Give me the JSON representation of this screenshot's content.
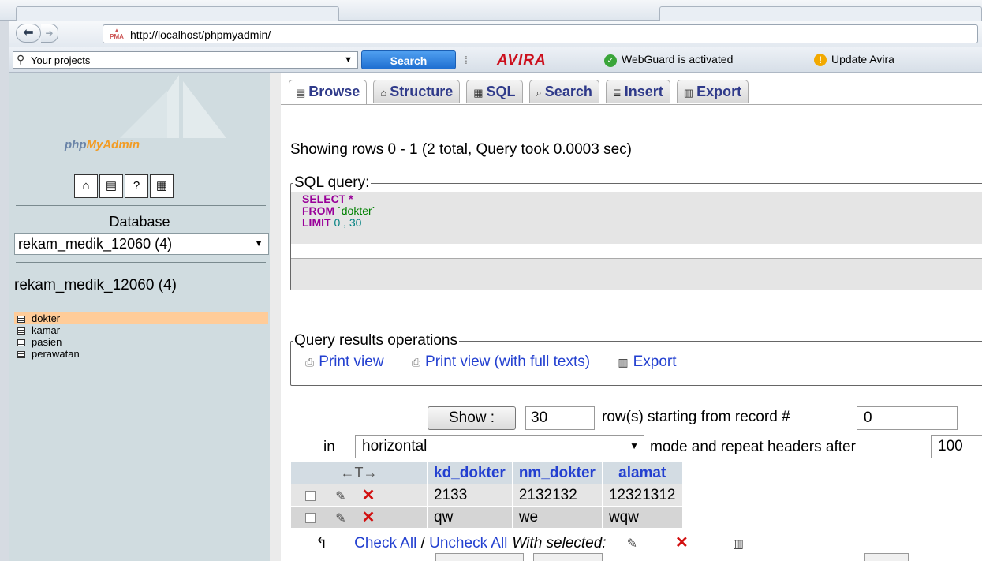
{
  "browser": {
    "url": "http://localhost/phpmyadmin/",
    "favicon_text": "PMA"
  },
  "toolbar": {
    "search_value": "Your projects",
    "search_button": "Search",
    "avira_logo": "AVIRA",
    "webguard": "WebGuard is activated",
    "update": "Update Avira"
  },
  "sidebar": {
    "logo_php": "php",
    "logo_my": "MyAdmin",
    "database_label": "Database",
    "database_selected": "rekam_medik_12060 (4)",
    "database_heading": "rekam_medik_12060 (4)",
    "tables": [
      "dokter",
      "kamar",
      "pasien",
      "perawatan"
    ],
    "selected_table": "dokter",
    "quick_icons": [
      "home-icon",
      "sql-query-icon",
      "docs-icon",
      "sql-docs-icon"
    ]
  },
  "tabs": [
    {
      "label": "Browse",
      "icon": "▤"
    },
    {
      "label": "Structure",
      "icon": "⌂"
    },
    {
      "label": "SQL",
      "icon": "▦"
    },
    {
      "label": "Search",
      "icon": "⌕"
    },
    {
      "label": "Insert",
      "icon": "≣"
    },
    {
      "label": "Export",
      "icon": "▥"
    }
  ],
  "active_tab": "Browse",
  "main": {
    "rows_info": "Showing rows 0 - 1 (2 total, Query took 0.0003 sec)",
    "sql_legend": "SQL query:",
    "sql": {
      "select": "SELECT",
      "select_star": "*",
      "from": "FROM",
      "table": "`dokter`",
      "limit": "LIMIT",
      "limit_args": "0 , 30"
    },
    "ops_legend": "Query results operations",
    "ops": {
      "print_view": "Print view",
      "print_full": "Print view (with full texts)",
      "export": "Export"
    },
    "nav": {
      "show_button": "Show :",
      "rows_value": "30",
      "rows_text": "row(s) starting from record #",
      "start_value": "0",
      "in_text": "in",
      "mode_value": "horizontal",
      "mode_text": "mode and repeat headers after",
      "repeat_value": "100"
    }
  },
  "results": {
    "arrows_header": "←T→",
    "columns": [
      "kd_dokter",
      "nm_dokter",
      "alamat"
    ],
    "rows": [
      [
        "2133",
        "2132132",
        "12321312"
      ],
      [
        "qw",
        "we",
        "wqw"
      ]
    ]
  },
  "footer": {
    "check_all": "Check All",
    "separator": "/",
    "uncheck_all": "Uncheck All",
    "with_selected": "With selected:"
  }
}
